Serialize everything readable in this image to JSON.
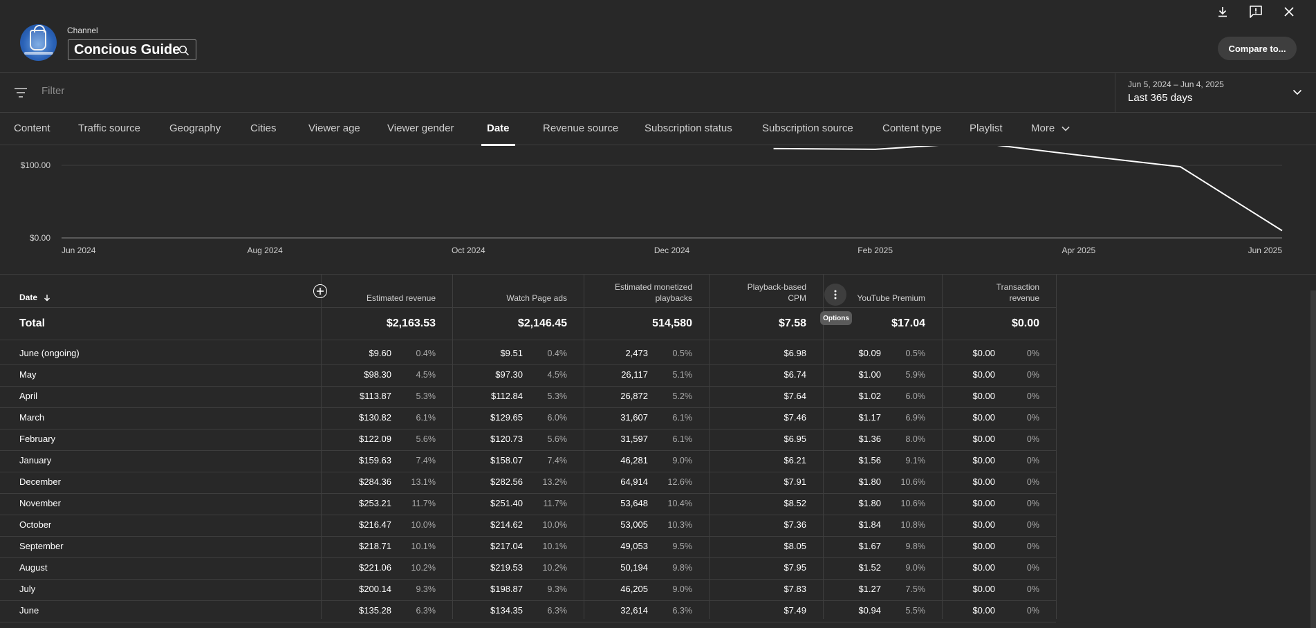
{
  "header": {
    "channel_label": "Channel",
    "channel_name": "Concious Guide",
    "compare_label": "Compare to..."
  },
  "filter": {
    "placeholder": "Filter",
    "date_range_sub": "Jun 5, 2024 – Jun 4, 2025",
    "date_range_main": "Last 365 days"
  },
  "tabs": [
    {
      "label": "Content"
    },
    {
      "label": "Traffic source"
    },
    {
      "label": "Geography"
    },
    {
      "label": "Cities"
    },
    {
      "label": "Viewer age"
    },
    {
      "label": "Viewer gender"
    },
    {
      "label": "Date",
      "active": true
    },
    {
      "label": "Revenue source"
    },
    {
      "label": "Subscription status"
    },
    {
      "label": "Subscription source"
    },
    {
      "label": "Content type"
    },
    {
      "label": "Playlist"
    },
    {
      "label": "More"
    }
  ],
  "chart_data": {
    "type": "line",
    "y_tick_labels": [
      "$100.00",
      "$0.00"
    ],
    "x_tick_labels": [
      "Jun 2024",
      "Aug 2024",
      "Oct 2024",
      "Dec 2024",
      "Feb 2025",
      "Apr 2025",
      "Jun 2025"
    ],
    "visible_points": [
      {
        "x": "Jan 2025",
        "y": 123
      },
      {
        "x": "Feb 2025",
        "y": 122
      },
      {
        "x": "Mar 2025",
        "y": 131
      },
      {
        "x": "Apr 2025",
        "y": 114
      },
      {
        "x": "May 2025",
        "y": 98
      },
      {
        "x": "Jun 2025",
        "y": 10
      }
    ],
    "ylim": [
      0,
      130
    ]
  },
  "table": {
    "headers": {
      "date": "Date",
      "estimated_revenue": "Estimated revenue",
      "watch_page_ads": "Watch Page ads",
      "monetized_playbacks_line1": "Estimated monetized",
      "monetized_playbacks_line2": "playbacks",
      "cpm_line1": "Playback-based",
      "cpm_line2": "CPM",
      "youtube_premium": "YouTube Premium",
      "transaction_line1": "Transaction",
      "transaction_line2": "revenue"
    },
    "options_tooltip": "Options",
    "total": {
      "label": "Total",
      "estimated_revenue": "$2,163.53",
      "watch_page_ads": "$2,146.45",
      "monetized_playbacks": "514,580",
      "cpm": "$7.58",
      "youtube_premium": "$17.04",
      "transaction_revenue": "$0.00"
    },
    "rows": [
      {
        "date": "June (ongoing)",
        "rev": "$9.60",
        "rev_pct": "0.4%",
        "wpa": "$9.51",
        "wpa_pct": "0.4%",
        "mp": "2,473",
        "mp_pct": "0.5%",
        "cpm": "$6.98",
        "ytp": "$0.09",
        "ytp_pct": "0.5%",
        "tr": "$0.00",
        "tr_pct": "0%"
      },
      {
        "date": "May",
        "rev": "$98.30",
        "rev_pct": "4.5%",
        "wpa": "$97.30",
        "wpa_pct": "4.5%",
        "mp": "26,117",
        "mp_pct": "5.1%",
        "cpm": "$6.74",
        "ytp": "$1.00",
        "ytp_pct": "5.9%",
        "tr": "$0.00",
        "tr_pct": "0%"
      },
      {
        "date": "April",
        "rev": "$113.87",
        "rev_pct": "5.3%",
        "wpa": "$112.84",
        "wpa_pct": "5.3%",
        "mp": "26,872",
        "mp_pct": "5.2%",
        "cpm": "$7.64",
        "ytp": "$1.02",
        "ytp_pct": "6.0%",
        "tr": "$0.00",
        "tr_pct": "0%"
      },
      {
        "date": "March",
        "rev": "$130.82",
        "rev_pct": "6.1%",
        "wpa": "$129.65",
        "wpa_pct": "6.0%",
        "mp": "31,607",
        "mp_pct": "6.1%",
        "cpm": "$7.46",
        "ytp": "$1.17",
        "ytp_pct": "6.9%",
        "tr": "$0.00",
        "tr_pct": "0%"
      },
      {
        "date": "February",
        "rev": "$122.09",
        "rev_pct": "5.6%",
        "wpa": "$120.73",
        "wpa_pct": "5.6%",
        "mp": "31,597",
        "mp_pct": "6.1%",
        "cpm": "$6.95",
        "ytp": "$1.36",
        "ytp_pct": "8.0%",
        "tr": "$0.00",
        "tr_pct": "0%"
      },
      {
        "date": "January",
        "rev": "$159.63",
        "rev_pct": "7.4%",
        "wpa": "$158.07",
        "wpa_pct": "7.4%",
        "mp": "46,281",
        "mp_pct": "9.0%",
        "cpm": "$6.21",
        "ytp": "$1.56",
        "ytp_pct": "9.1%",
        "tr": "$0.00",
        "tr_pct": "0%"
      },
      {
        "date": "December",
        "rev": "$284.36",
        "rev_pct": "13.1%",
        "wpa": "$282.56",
        "wpa_pct": "13.2%",
        "mp": "64,914",
        "mp_pct": "12.6%",
        "cpm": "$7.91",
        "ytp": "$1.80",
        "ytp_pct": "10.6%",
        "tr": "$0.00",
        "tr_pct": "0%"
      },
      {
        "date": "November",
        "rev": "$253.21",
        "rev_pct": "11.7%",
        "wpa": "$251.40",
        "wpa_pct": "11.7%",
        "mp": "53,648",
        "mp_pct": "10.4%",
        "cpm": "$8.52",
        "ytp": "$1.80",
        "ytp_pct": "10.6%",
        "tr": "$0.00",
        "tr_pct": "0%"
      },
      {
        "date": "October",
        "rev": "$216.47",
        "rev_pct": "10.0%",
        "wpa": "$214.62",
        "wpa_pct": "10.0%",
        "mp": "53,005",
        "mp_pct": "10.3%",
        "cpm": "$7.36",
        "ytp": "$1.84",
        "ytp_pct": "10.8%",
        "tr": "$0.00",
        "tr_pct": "0%"
      },
      {
        "date": "September",
        "rev": "$218.71",
        "rev_pct": "10.1%",
        "wpa": "$217.04",
        "wpa_pct": "10.1%",
        "mp": "49,053",
        "mp_pct": "9.5%",
        "cpm": "$8.05",
        "ytp": "$1.67",
        "ytp_pct": "9.8%",
        "tr": "$0.00",
        "tr_pct": "0%"
      },
      {
        "date": "August",
        "rev": "$221.06",
        "rev_pct": "10.2%",
        "wpa": "$219.53",
        "wpa_pct": "10.2%",
        "mp": "50,194",
        "mp_pct": "9.8%",
        "cpm": "$7.95",
        "ytp": "$1.52",
        "ytp_pct": "9.0%",
        "tr": "$0.00",
        "tr_pct": "0%"
      },
      {
        "date": "July",
        "rev": "$200.14",
        "rev_pct": "9.3%",
        "wpa": "$198.87",
        "wpa_pct": "9.3%",
        "mp": "46,205",
        "mp_pct": "9.0%",
        "cpm": "$7.83",
        "ytp": "$1.27",
        "ytp_pct": "7.5%",
        "tr": "$0.00",
        "tr_pct": "0%"
      },
      {
        "date": "June",
        "rev": "$135.28",
        "rev_pct": "6.3%",
        "wpa": "$134.35",
        "wpa_pct": "6.3%",
        "mp": "32,614",
        "mp_pct": "6.3%",
        "cpm": "$7.49",
        "ytp": "$0.94",
        "ytp_pct": "5.5%",
        "tr": "$0.00",
        "tr_pct": "0%"
      }
    ]
  },
  "icons": {
    "download": "download-icon",
    "feedback": "feedback-icon",
    "close": "close-icon",
    "search": "search-icon",
    "filter": "filter-icon",
    "chevron": "chevron-down-icon",
    "options": "more-vert-icon",
    "add_column": "add-circle-icon"
  },
  "colors": {
    "background": "#282828",
    "text": "#ffffff",
    "muted": "#aaaaaa",
    "divider": "#3e3e3e"
  }
}
